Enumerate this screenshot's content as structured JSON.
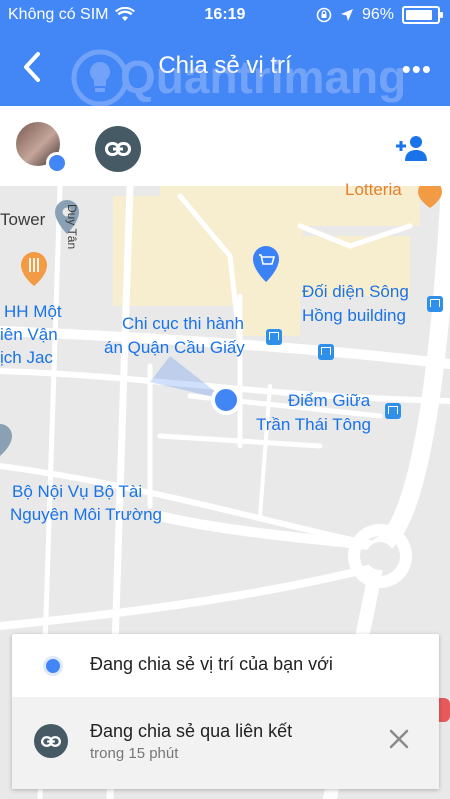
{
  "status_bar": {
    "carrier": "Không có SIM",
    "time": "16:19",
    "battery": "96%"
  },
  "header": {
    "title": "Chia sẻ vị trí",
    "more": "•••",
    "watermark": "Quantrimang"
  },
  "map": {
    "labels": {
      "lotteria": "Lotteria",
      "duy_tan": "Duy Tân",
      "tower": "Tower",
      "hh_mot": "HH Một",
      "ien_van": "iên Vận",
      "ich_jac": "ịch Jac",
      "doi_dien_1": "Đối diện Sông",
      "doi_dien_2": "Hồng building",
      "chi_cuc_1": "Chi cục thi hành",
      "chi_cuc_2": "án Quận Cầu Giấy",
      "diem_giua_1": "Điểm Giữa",
      "diem_giua_2": "Trần Thái Tông",
      "bo_noi_vu_1": "Bộ Nội Vụ Bộ Tài",
      "bo_noi_vu_2": "Nguyên Môi Trường"
    },
    "colors": {
      "background": "#e9e9e9",
      "road": "#ffffff",
      "block": "#f7eed0",
      "label": "#1a73e8",
      "location": "#4285f4"
    }
  },
  "sheet": {
    "sharing_with": "Đang chia sẻ vị trí của bạn với",
    "sharing_link": "Đang chia sẻ qua liên kết",
    "duration": "trong 15 phút"
  },
  "icons": [
    "back-icon",
    "more-icon",
    "link-icon",
    "add-person-icon",
    "wifi-icon",
    "location-arrow-icon",
    "lock-rotation-icon",
    "battery-icon",
    "restaurant-icon",
    "shopping-icon",
    "place-icon",
    "bus-stop-icon",
    "close-icon"
  ]
}
